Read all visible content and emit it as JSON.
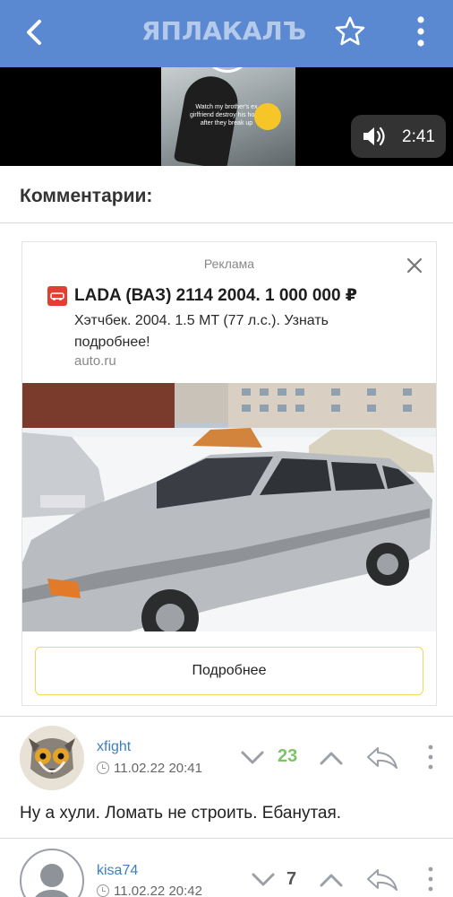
{
  "header": {
    "logo": "ЯПЛАКАЛЪ",
    "back_icon": "back-arrow-icon",
    "star_icon": "star-icon",
    "more_icon": "more-vertical-icon",
    "bg_color": "#5a89d1"
  },
  "video": {
    "thumbnail_caption": "Watch my brother's ex girlfriend destroy his home after they break up",
    "duration": "2:41",
    "sound_icon": "volume-icon"
  },
  "comments_heading": "Комментарии:",
  "ad": {
    "label": "Реклама",
    "title": "LADA (ВАЗ) 2114 2004. 1 000 000 ₽",
    "description": "Хэтчбек. 2004. 1.5 MT (77 л.с.). Узнать подробнее!",
    "domain": "auto.ru",
    "button": "Подробнее",
    "brand_color": "#e23f33"
  },
  "comments": [
    {
      "username": "xfight",
      "date": "11.02.22 20:41",
      "score": "23",
      "score_color": "#7cc36a",
      "text": "Ну а хули. Ломать не строить. Ебанутая."
    },
    {
      "username": "kisa74",
      "date": "11.02.22 20:42",
      "score": "7",
      "score_color": "#555555",
      "text": ""
    }
  ]
}
